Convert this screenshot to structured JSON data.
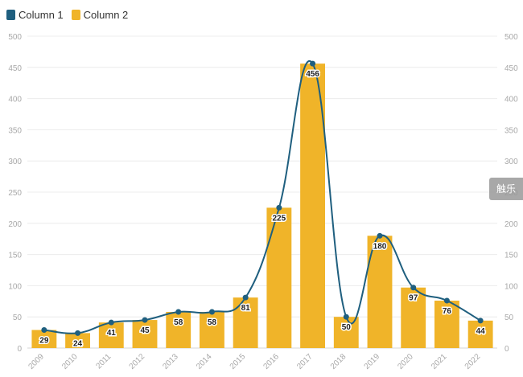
{
  "chart_data": {
    "type": "bar+line",
    "title": "",
    "xlabel": "",
    "ylabel": "",
    "categories": [
      "2009",
      "2010",
      "2011",
      "2012",
      "2013",
      "2014",
      "2015",
      "2016",
      "2017",
      "2018",
      "2019",
      "2020",
      "2021",
      "2022"
    ],
    "series": [
      {
        "name": "Column 1",
        "type": "line",
        "color": "#1f5f7f",
        "values": [
          29,
          24,
          41,
          45,
          58,
          58,
          81,
          225,
          456,
          50,
          180,
          97,
          76,
          44
        ]
      },
      {
        "name": "Column 2",
        "type": "bar",
        "color": "#f0b429",
        "values": [
          29,
          24,
          41,
          45,
          58,
          58,
          81,
          225,
          456,
          50,
          180,
          97,
          76,
          44
        ]
      }
    ],
    "data_labels": [
      29,
      24,
      41,
      45,
      58,
      58,
      81,
      225,
      456,
      50,
      180,
      97,
      76,
      44
    ],
    "ylim": [
      0,
      500
    ],
    "yticks": [
      "0",
      "50",
      "100",
      "150",
      "200",
      "250",
      "300",
      "350",
      "400",
      "450",
      "500"
    ],
    "y2ticks": [
      "0",
      "50",
      "100",
      "150",
      "200",
      "250",
      "300",
      "350",
      "400",
      "450",
      "500"
    ],
    "grid": true,
    "legend_position": "top-left"
  },
  "watermark": {
    "text": "触乐"
  }
}
